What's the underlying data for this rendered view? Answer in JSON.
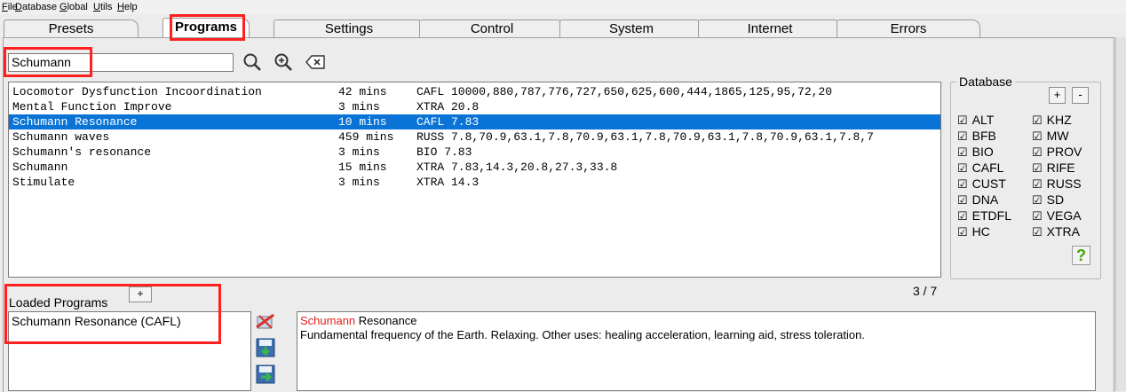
{
  "menu": [
    {
      "label": "File",
      "accel": "F"
    },
    {
      "label": "Database",
      "accel": "D"
    },
    {
      "label": "Global",
      "accel": "G"
    },
    {
      "label": "Utils",
      "accel": "U"
    },
    {
      "label": "Help",
      "accel": "H"
    }
  ],
  "tabs": [
    {
      "label": "Presets"
    },
    {
      "label": "Programs"
    },
    {
      "label": "Settings"
    },
    {
      "label": "Control"
    },
    {
      "label": "System"
    },
    {
      "label": "Internet"
    },
    {
      "label": "Errors"
    }
  ],
  "active_tab": "Programs",
  "search": {
    "value": "Schumann"
  },
  "programs": [
    {
      "name": "Locomotor Dysfunction Incoordination",
      "duration": "42 mins",
      "freqs": "CAFL 10000,880,787,776,727,650,625,600,444,1865,125,95,72,20"
    },
    {
      "name": "Mental Function Improve",
      "duration": "3 mins",
      "freqs": "XTRA 20.8"
    },
    {
      "name": "Schumann Resonance",
      "duration": "10 mins",
      "freqs": "CAFL 7.83",
      "selected": true
    },
    {
      "name": "Schumann waves",
      "duration": "459 mins",
      "freqs": "RUSS 7.8,70.9,63.1,7.8,70.9,63.1,7.8,70.9,63.1,7.8,70.9,63.1,7.8,7"
    },
    {
      "name": "Schumann's resonance",
      "duration": "3 mins",
      "freqs": "BIO  7.83"
    },
    {
      "name": "Schumann",
      "duration": "15 mins",
      "freqs": "XTRA 7.83,14.3,20.8,27.3,33.8"
    },
    {
      "name": "Stimulate",
      "duration": "3 mins",
      "freqs": "XTRA 14.3"
    }
  ],
  "database": {
    "title": "Database",
    "add_label": "+",
    "remove_label": "-",
    "left": [
      "ALT",
      "BFB",
      "BIO",
      "CAFL",
      "CUST",
      "DNA",
      "ETDFL",
      "HC"
    ],
    "right": [
      "KHZ",
      "MW",
      "PROV",
      "RIFE",
      "RUSS",
      "SD",
      "VEGA",
      "XTRA"
    ],
    "check_glyph": "☑",
    "help_label": "?"
  },
  "count": "3 / 7",
  "loaded": {
    "label": "Loaded Programs",
    "add_label": "+",
    "items": [
      "Schumann Resonance (CAFL)"
    ]
  },
  "description": {
    "highlight": "Schumann",
    "title_rest": " Resonance",
    "text": "Fundamental frequency of the Earth. Relaxing. Other uses: healing acceleration, learning aid, stress toleration."
  },
  "colors": {
    "selection": "#0a74d6",
    "annotation": "#ff2020",
    "highlight": "#e0201c",
    "help": "#3da400"
  }
}
